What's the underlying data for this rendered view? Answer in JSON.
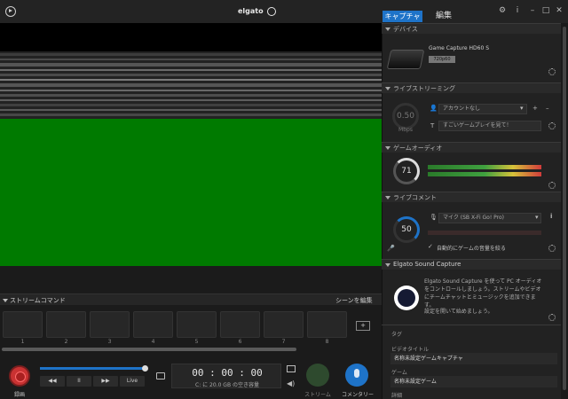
{
  "titlebar": {
    "brand": "elgato",
    "tabs": {
      "capture": "キャプチャ",
      "edit": "編集"
    },
    "buttons": {
      "settings": "⚙",
      "info": "i",
      "minimize": "–",
      "maximize": "□",
      "close": "✕"
    }
  },
  "stream_command": {
    "title": "ストリームコマンド",
    "edit_scenes": "シーンを編集",
    "slots": [
      "1",
      "2",
      "3",
      "4",
      "5",
      "6",
      "7",
      "8"
    ],
    "add_label": "+"
  },
  "controls": {
    "record_label": "録画",
    "playback": [
      "◀◀",
      "II",
      "▶▶",
      "Live"
    ],
    "timer": "00 : 00 : 00",
    "free_space": "C: に 20.0 GB の空き容量",
    "stream_label": "ストリーム",
    "commentary_label": "コメンタリー"
  },
  "panel": {
    "device": {
      "title": "デバイス",
      "name": "Game Capture HD60 S",
      "resolution": "720p60"
    },
    "live_streaming": {
      "title": "ライブストリーミング",
      "bitrate": "0.50",
      "bitrate_unit": "Mbps",
      "account": "アカウントなし",
      "stream_title": "すごいゲームプレイを見て！"
    },
    "game_audio": {
      "title": "ゲームオーディオ",
      "level": "71"
    },
    "live_commentary": {
      "title": "ライブコメント",
      "level": "50",
      "mic": "マイク (SB X-Fi Go! Pro)",
      "auto_duck": "自動的にゲームの音量を絞る"
    },
    "sound_capture": {
      "title": "Elgato Sound Capture",
      "description": "Elgato Sound Capture を使って PC オーディオをコントロールしましょう。ストリームやビデオにチームチャットとミュージックを追加できます。",
      "settings_text": "設定を開いて始めましょう。"
    },
    "metadata": {
      "tags_label": "タグ",
      "video_title_label": "ビデオタイトル",
      "video_title": "名称未設定ゲームキャプチャ",
      "game_label": "ゲーム",
      "game": "名称未設定ゲーム",
      "details_label": "詳細"
    }
  },
  "colors": {
    "accent": "#1e73c8",
    "record": "#c93232",
    "video_green": "#007a00"
  }
}
